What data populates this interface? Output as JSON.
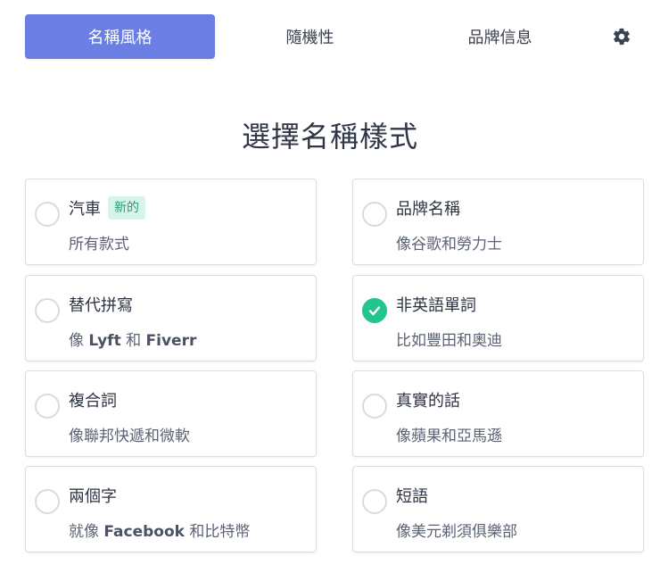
{
  "tabs": [
    {
      "label": "名稱風格",
      "active": true
    },
    {
      "label": "隨機性",
      "active": false
    },
    {
      "label": "品牌信息",
      "active": false
    }
  ],
  "settings_icon": "gear-icon",
  "heading": "選擇名稱樣式",
  "accent_color": "#6b7ee3",
  "check_color": "#22c58e",
  "options": [
    {
      "title": "汽車",
      "badge": "新的",
      "sub": "所有款式",
      "checked": false
    },
    {
      "title": "品牌名稱",
      "badge": "",
      "sub": "像谷歌和勞力士",
      "checked": false
    },
    {
      "title": "替代拼寫",
      "badge": "",
      "sub_pre": "像 ",
      "sub_b1": "Lyft",
      "sub_mid": " 和 ",
      "sub_b2": "Fiverr",
      "checked": false
    },
    {
      "title": "非英語單詞",
      "badge": "",
      "sub": "比如豐田和奧迪",
      "checked": true
    },
    {
      "title": "複合詞",
      "badge": "",
      "sub": "像聯邦快遞和微軟",
      "checked": false
    },
    {
      "title": "真實的話",
      "badge": "",
      "sub": "像蘋果和亞馬遜",
      "checked": false
    },
    {
      "title": "兩個字",
      "badge": "",
      "sub_pre": "就像 ",
      "sub_b1": "Facebook",
      "sub_mid": " 和比特幣",
      "sub_b2": "",
      "checked": false
    },
    {
      "title": "短語",
      "badge": "",
      "sub": "像美元剃須俱樂部",
      "checked": false
    }
  ]
}
